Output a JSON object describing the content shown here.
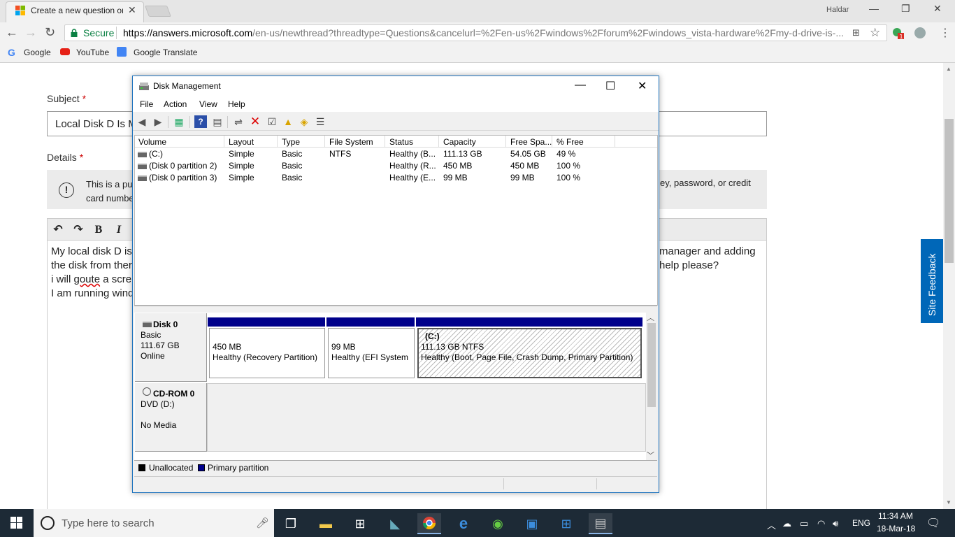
{
  "browser": {
    "tab_title": "Create a new question or",
    "profile_name": "Haldar",
    "secure_label": "Secure",
    "url_host": "https://answers.microsoft.com",
    "url_rest": "/en-us/newthread?threadtype=Questions&cancelurl=%2Fen-us%2Fwindows%2Fforum%2Fwindows_vista-hardware%2Fmy-d-drive-is-...",
    "extension_badge": "1",
    "bookmarks": [
      "Google",
      "YouTube",
      "Google Translate"
    ]
  },
  "page": {
    "subject_label": "Subject",
    "required_mark": "*",
    "subject_value": "Local Disk D Is M",
    "details_label": "Details",
    "notice_line1_left": "This is a pul",
    "notice_line2_left": "card numbe",
    "notice_line1_right": "ey, password, or credit",
    "editor_buttons": [
      "↶",
      "↷",
      "B",
      "I"
    ],
    "body_lines_left": [
      "My local disk D is",
      "the disk from ther",
      "i will ",
      "goute",
      " a scre",
      "I am running wind"
    ],
    "body_lines_right": [
      "manager and adding",
      "help please?"
    ],
    "site_feedback": "Site Feedback"
  },
  "disk_mgmt": {
    "title": "Disk Management",
    "menu": [
      "File",
      "Action",
      "View",
      "Help"
    ],
    "columns": [
      "Volume",
      "Layout",
      "Type",
      "File System",
      "Status",
      "Capacity",
      "Free Spa...",
      "% Free"
    ],
    "volumes": [
      {
        "volume": "(C:)",
        "layout": "Simple",
        "type": "Basic",
        "fs": "NTFS",
        "status": "Healthy (B...",
        "capacity": "111.13 GB",
        "free": "54.05 GB",
        "pct": "49 %"
      },
      {
        "volume": "(Disk 0 partition 2)",
        "layout": "Simple",
        "type": "Basic",
        "fs": "",
        "status": "Healthy (R...",
        "capacity": "450 MB",
        "free": "450 MB",
        "pct": "100 %"
      },
      {
        "volume": "(Disk 0 partition 3)",
        "layout": "Simple",
        "type": "Basic",
        "fs": "",
        "status": "Healthy (E...",
        "capacity": "99 MB",
        "free": "99 MB",
        "pct": "100 %"
      }
    ],
    "disk0": {
      "name": "Disk 0",
      "type": "Basic",
      "size": "111.67 GB",
      "state": "Online"
    },
    "partitions": [
      {
        "name": "",
        "size": "450 MB",
        "desc": "Healthy (Recovery Partition)"
      },
      {
        "name": "",
        "size": "99 MB",
        "desc": "Healthy (EFI System P"
      },
      {
        "name": "(C:)",
        "size": "111.13 GB NTFS",
        "desc": "Healthy (Boot, Page File, Crash Dump, Primary Partition)"
      }
    ],
    "cdrom": {
      "name": "CD-ROM 0",
      "drive": "DVD (D:)",
      "media": "No Media"
    },
    "legend": [
      {
        "label": "Unallocated",
        "color": "#000000"
      },
      {
        "label": "Primary partition",
        "color": "#00008b"
      }
    ]
  },
  "taskbar": {
    "search_placeholder": "Type here to search",
    "language": "ENG",
    "time": "11:34 AM",
    "date": "18-Mar-18"
  },
  "colors": {
    "accent": "#1e73be",
    "feedback": "#0067b8",
    "partition_bar": "#00008b",
    "secure_green": "#0b8043"
  }
}
